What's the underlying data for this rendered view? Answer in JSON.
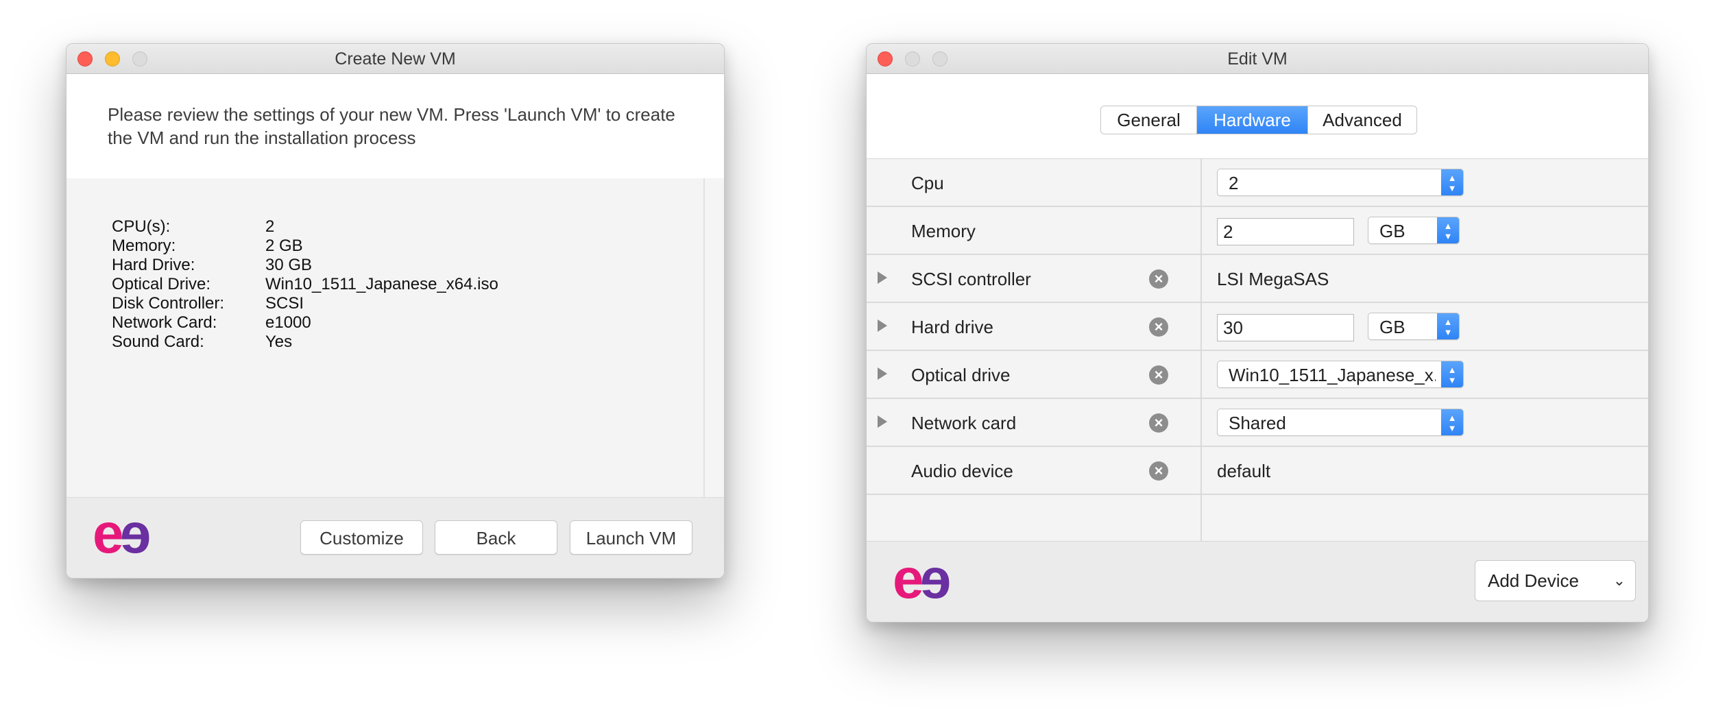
{
  "create_window": {
    "title": "Create New VM",
    "intro": "Please review the settings of your new VM. Press 'Launch VM' to create the VM and run the installation process",
    "summary": [
      {
        "key": "CPU(s):",
        "value": "2"
      },
      {
        "key": "Memory:",
        "value": "2 GB"
      },
      {
        "key": "Hard Drive:",
        "value": "30 GB"
      },
      {
        "key": "Optical Drive:",
        "value": "Win10_1511_Japanese_x64.iso"
      },
      {
        "key": "Disk Controller:",
        "value": "SCSI"
      },
      {
        "key": "Network Card:",
        "value": "e1000"
      },
      {
        "key": "Sound Card:",
        "value": "Yes"
      }
    ],
    "buttons": {
      "customize": "Customize",
      "back": "Back",
      "launch": "Launch VM"
    }
  },
  "edit_window": {
    "title": "Edit VM",
    "tabs": [
      {
        "label": "General"
      },
      {
        "label": "Hardware",
        "active": true
      },
      {
        "label": "Advanced"
      }
    ],
    "rows": {
      "cpu": {
        "label": "Cpu",
        "value": "2"
      },
      "memory": {
        "label": "Memory",
        "value": "2",
        "unit": "GB"
      },
      "scsi": {
        "label": "SCSI controller",
        "value": "LSI MegaSAS"
      },
      "hard_drive": {
        "label": "Hard drive",
        "value": "30",
        "unit": "GB"
      },
      "optical": {
        "label": "Optical drive",
        "value": "Win10_1511_Japanese_x..."
      },
      "network": {
        "label": "Network card",
        "value": "Shared"
      },
      "audio": {
        "label": "Audio device",
        "value": "default"
      }
    },
    "add_device": "Add Device"
  },
  "logo": {
    "text_left": "e",
    "text_right": "e"
  },
  "colors": {
    "accent_blue": "#2f84f6",
    "logo_pink": "#e6197a",
    "logo_purple": "#6a2fa0"
  },
  "icons": {
    "remove": "remove-circle-icon",
    "expand": "disclosure-triangle-icon",
    "stepper": "up-down-chevron-icon"
  }
}
